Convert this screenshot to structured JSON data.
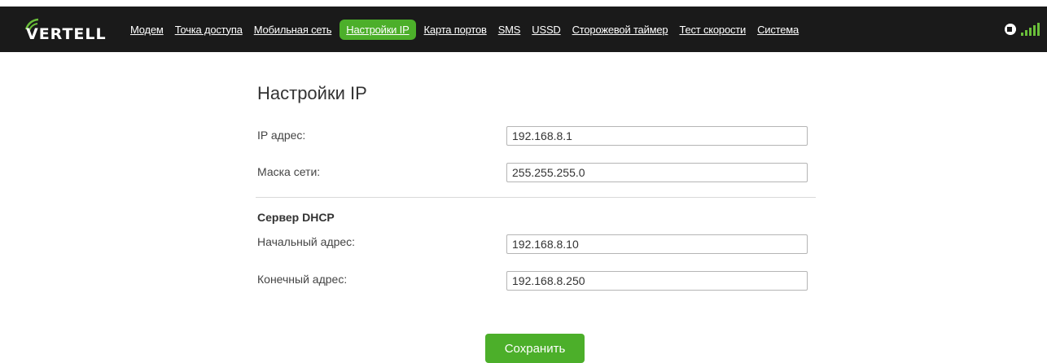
{
  "header": {
    "logo_text": "VERTELL",
    "nav": [
      {
        "label": "Модем"
      },
      {
        "label": "Точка доступа"
      },
      {
        "label": "Мобильная сеть"
      },
      {
        "label": "Настройки IP",
        "active": true
      },
      {
        "label": "Карта портов"
      },
      {
        "label": "SMS"
      },
      {
        "label": "USSD"
      },
      {
        "label": "Сторожевой таймер"
      },
      {
        "label": "Тест скорости"
      },
      {
        "label": "Система"
      }
    ],
    "icons": [
      "ethernet-icon",
      "signal-strength-icon"
    ]
  },
  "main": {
    "title": "Настройки IP",
    "ip_address": {
      "label": "IP адрес:",
      "value": "192.168.8.1"
    },
    "netmask": {
      "label": "Маска сети:",
      "value": "255.255.255.0"
    },
    "dhcp": {
      "title": "Сервер DHCP",
      "start": {
        "label": "Начальный адрес:",
        "value": "192.168.8.10"
      },
      "end": {
        "label": "Конечный адрес:",
        "value": "192.168.8.250"
      }
    },
    "save_label": "Сохранить"
  },
  "colors": {
    "topbar": "#1a1a1a",
    "accent": "#4caf2a",
    "signal": "#6abf3a"
  }
}
